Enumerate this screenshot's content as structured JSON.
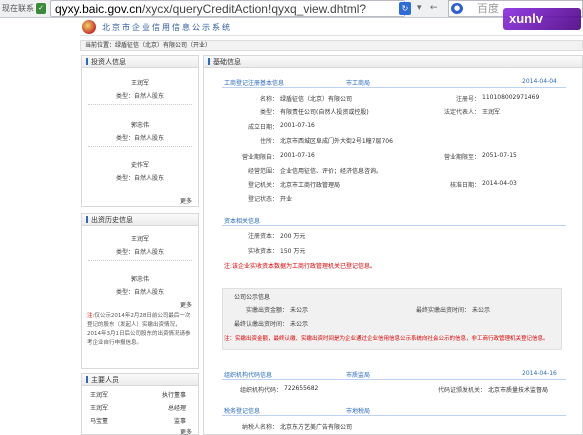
{
  "browser": {
    "status_text": "现在联系",
    "url_host": "qyxy.baic.gov.cn",
    "url_path": "/xycx/queryCreditAction!qyxq_view.dhtml?",
    "search_placeholder": "百度",
    "watermark": "xunlv"
  },
  "site": {
    "title": "北京市企业信用信息公示系统",
    "breadcrumb": "当前位置：绿盾征信（北京）有限公司（开业）"
  },
  "left": {
    "investors": {
      "heading": "投资人信息",
      "items": [
        {
          "name": "王润军",
          "type": "类型：自然人股东"
        },
        {
          "name": "郭忠伟",
          "type": "类型：自然人股东"
        },
        {
          "name": "史作军",
          "type": "类型：自然人股东"
        }
      ],
      "more": "更多"
    },
    "history": {
      "heading": "出资历史信息",
      "items": [
        {
          "name": "王润军",
          "type": "类型：自然人股东"
        },
        {
          "name": "郭忠伟",
          "type": "类型：自然人股东"
        }
      ],
      "more": "更多",
      "note_prefix": "注:",
      "note": "仅公示2014年2月28日前公司最后一次登记的股东（发起人）实缴出资情况，2014年3月1日后公司股东的出资情况请参考企业自行申报信息。"
    },
    "staff": {
      "heading": "主要人员",
      "rows": [
        {
          "name": "王润军",
          "role": "执行董事"
        },
        {
          "name": "王润军",
          "role": "总经理"
        },
        {
          "name": "马宝董",
          "role": "监事"
        }
      ],
      "more": "更多"
    }
  },
  "right": {
    "heading": "基础信息",
    "reg": {
      "title": "工商登记注册基本信息",
      "source": "市工商局",
      "date": "2014-04-04",
      "fields": {
        "name_label": "名称：",
        "name": "绿盾征信（北京）有限公司",
        "regno_label": "注册号：",
        "regno": "110108002971469",
        "type_label": "类型：",
        "type": "有限责任公司(自然人投资或控股)",
        "legal_label": "法定代表人：",
        "legal": "王润军",
        "founded_label": "成立日期：",
        "founded": "2001-07-16",
        "addr_label": "住所：",
        "addr": "北京市西城区阜成门外大街2号1幢7层706",
        "term_start_label": "营业期限自：",
        "term_start": "2001-07-16",
        "term_end_label": "营业期限至：",
        "term_end": "2051-07-15",
        "scope_label": "经营范围：",
        "scope": "企业信用征信、评价；经济信息咨询。",
        "authority_label": "登记机关：",
        "authority": "北京市工商行政管理局",
        "approved_label": "核准日期：",
        "approved": "2014-04-03",
        "status_label": "登记状态：",
        "status": "开业"
      }
    },
    "capital": {
      "title": "资本相关信息",
      "registered_label": "注册资本：",
      "registered": "200 万元",
      "paid_label": "实收资本：",
      "paid": "150 万元",
      "note": "注:该企业实收资本数据为工商行政管理机关已登记信息。"
    },
    "disclosure": {
      "title": "公司公示信息",
      "paid_time_label": "实缴出资金额：",
      "paid_time": "未公示",
      "last_paid_label": "最终实缴出资时间：",
      "last_paid": "未公示",
      "sub_time_label": "最终认缴出资时间：",
      "sub_time": "未公示",
      "note": "注：实缴出资金额，最终认缴、实缴出资时间是为企业通过企业信用信息公示系统向社会公示的信息，非工商行政管理机关登记信息。"
    },
    "org": {
      "title": "组织机构代码信息",
      "source": "市质监局",
      "date": "2014-04-16",
      "code_label": "组织机构代码：",
      "code": "722655682",
      "issuer_label": "代码证颁发机关：",
      "issuer": "北京市质量技术监督局"
    },
    "tax": {
      "title": "税务登记信息",
      "source": "市地税局",
      "taxpayer_label": "纳税人名称：",
      "taxpayer": "北京东方艺美广告有限公司"
    }
  }
}
